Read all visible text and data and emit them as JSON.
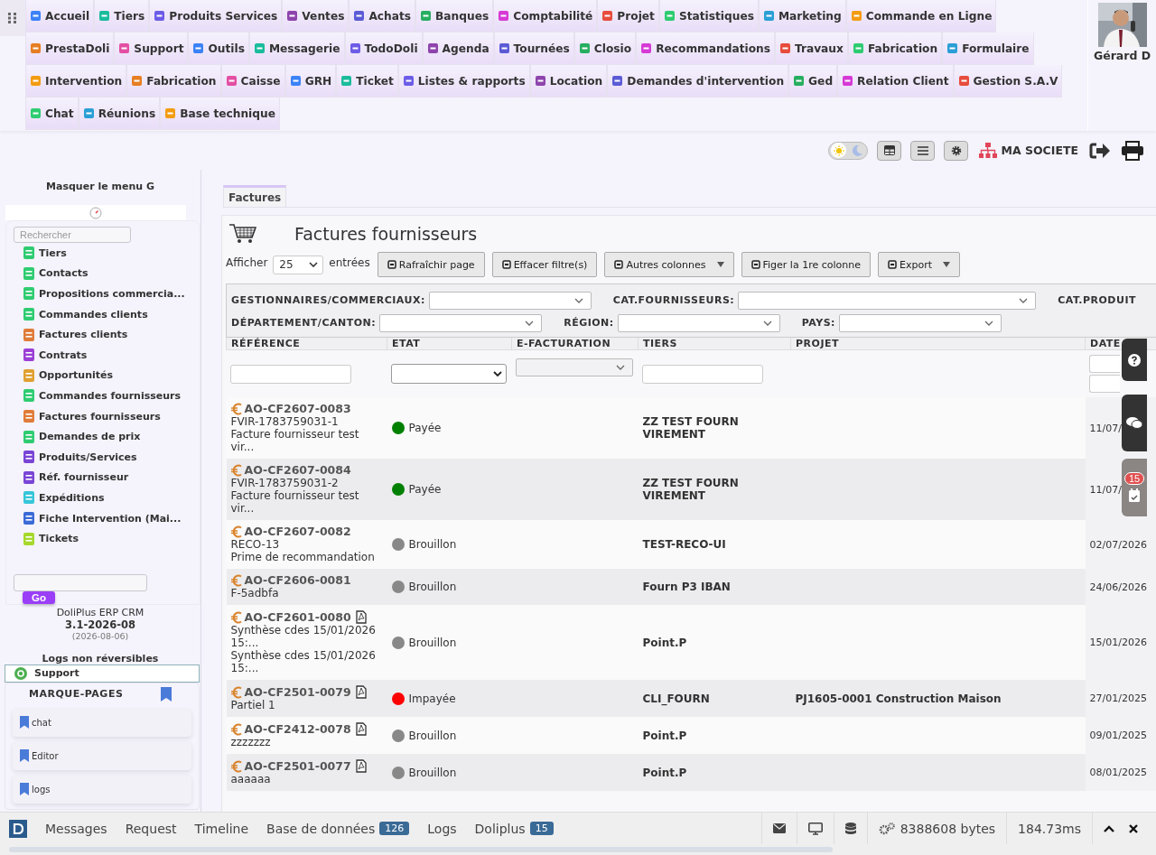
{
  "top_menu": {
    "items": [
      {
        "label": "Accueil"
      },
      {
        "label": "Tiers"
      },
      {
        "label": "Produits Services"
      },
      {
        "label": "Ventes"
      },
      {
        "label": "Achats"
      },
      {
        "label": "Banques"
      },
      {
        "label": "Comptabilité"
      },
      {
        "label": "Projet"
      },
      {
        "label": "Statistiques"
      },
      {
        "label": "Marketing"
      },
      {
        "label": "Commande en Ligne"
      },
      {
        "label": "PrestaDoli"
      },
      {
        "label": "Support"
      },
      {
        "label": "Outils"
      },
      {
        "label": "Messagerie"
      },
      {
        "label": "TodoDoli"
      },
      {
        "label": "Agenda"
      },
      {
        "label": "Tournées"
      },
      {
        "label": "Closio"
      },
      {
        "label": "Recommandations"
      },
      {
        "label": "Travaux"
      },
      {
        "label": "Fabrication"
      },
      {
        "label": "Formulaire"
      },
      {
        "label": "Intervention"
      },
      {
        "label": "Fabrication"
      },
      {
        "label": "Caisse"
      },
      {
        "label": "GRH"
      },
      {
        "label": "Ticket"
      },
      {
        "label": "Listes & rapports"
      },
      {
        "label": "Location"
      },
      {
        "label": "Demandes d'intervention"
      },
      {
        "label": "Ged"
      },
      {
        "label": "Relation Client"
      },
      {
        "label": "Gestion S.A.V"
      },
      {
        "label": "Chat"
      },
      {
        "label": "Réunions"
      },
      {
        "label": "Base technique"
      }
    ]
  },
  "user": {
    "name": "Gérard D"
  },
  "toolbar": {
    "dark_mode": false,
    "company": "MA SOCIETE"
  },
  "sidebar": {
    "hide_menu": "Masquer le menu G",
    "search": {
      "placeholder": "Rechercher"
    },
    "items": [
      {
        "label": "Tiers"
      },
      {
        "label": "Contacts"
      },
      {
        "label": "Propositions commercia..."
      },
      {
        "label": "Commandes clients"
      },
      {
        "label": "Factures clients"
      },
      {
        "label": "Contrats"
      },
      {
        "label": "Opportunités"
      },
      {
        "label": "Commandes fournisseurs"
      },
      {
        "label": "Factures fournisseurs"
      },
      {
        "label": "Demandes de prix"
      },
      {
        "label": "Produits/Services"
      },
      {
        "label": "Réf. fournisseur"
      },
      {
        "label": "Expéditions"
      },
      {
        "label": "Fiche Intervention (Mai..."
      },
      {
        "label": "Tickets"
      }
    ],
    "go_button": "Go",
    "app_name": "DoliPlus ERP CRM",
    "version": "3.1-2026-08",
    "build_date": "(2026-08-06)",
    "logs_note": "Logs non réversibles",
    "support": "Support",
    "bookmarks": {
      "title": "MARQUE-PAGES",
      "items": [
        "chat",
        "Editor",
        "logs"
      ]
    }
  },
  "main": {
    "tabs": [
      {
        "label": "Factures",
        "selected": true
      }
    ],
    "title": "Factures fournisseurs",
    "show_label": "Afficher",
    "page_size": "25",
    "entries_label": "entrées",
    "buttons": [
      {
        "label": "Rafraîchir page",
        "dropdown": false
      },
      {
        "label": "Effacer filtre(s)",
        "dropdown": false
      },
      {
        "label": "Autres colonnes",
        "dropdown": true
      },
      {
        "label": "Figer la 1re colonne",
        "dropdown": false
      },
      {
        "label": "Export",
        "dropdown": true
      }
    ],
    "filters": [
      [
        "GESTIONNAIRES/COMMERCIAUX:",
        "CAT.FOURNISSEURS:",
        "CAT.PRODUIT"
      ],
      [
        "DÉPARTEMENT/CANTON:",
        "RÉGION:",
        "PAYS:"
      ]
    ],
    "table": {
      "columns": [
        "RÉFÉRENCE",
        "ETAT",
        "E-FACTURATION",
        "TIERS",
        "PROJET",
        "DATE"
      ],
      "rows": [
        {
          "ref": "AO-CF2607-0083",
          "pdf": false,
          "lines": [
            "FVIR-1783759031-1",
            "Facture fournisseur test vir..."
          ],
          "status": {
            "label": "Payée",
            "color": "#008000"
          },
          "tiers": "ZZ TEST FOURN VIREMENT",
          "projet": "",
          "date": "11/07/"
        },
        {
          "ref": "AO-CF2607-0084",
          "pdf": false,
          "lines": [
            "FVIR-1783759031-2",
            "Facture fournisseur test vir..."
          ],
          "status": {
            "label": "Payée",
            "color": "#008000"
          },
          "tiers": "ZZ TEST FOURN VIREMENT",
          "projet": "",
          "date": "11/07/"
        },
        {
          "ref": "AO-CF2607-0082",
          "pdf": false,
          "lines": [
            "RECO-13",
            "Prime de recommandation"
          ],
          "status": {
            "label": "Brouillon",
            "color": "#888888"
          },
          "tiers": "TEST-RECO-UI",
          "projet": "",
          "date": "02/07/2026"
        },
        {
          "ref": "AO-CF2606-0081",
          "pdf": false,
          "lines": [
            "F-5adbfa"
          ],
          "status": {
            "label": "Brouillon",
            "color": "#888888"
          },
          "tiers": "Fourn P3 IBAN",
          "projet": "",
          "date": "24/06/2026"
        },
        {
          "ref": "AO-CF2601-0080",
          "pdf": true,
          "lines": [
            "Synthèse cdes 15/01/2026 15:...",
            "Synthèse cdes 15/01/2026 15:..."
          ],
          "status": {
            "label": "Brouillon",
            "color": "#888888"
          },
          "tiers": "Point.P",
          "projet": "",
          "date": "15/01/2026"
        },
        {
          "ref": "AO-CF2501-0079",
          "pdf": true,
          "lines": [
            "Partiel 1"
          ],
          "status": {
            "label": "Impayée",
            "color": "#ff0000"
          },
          "tiers": "CLI_FOURN",
          "projet": "PJ1605-0001 Construction Maison",
          "date": "27/01/2025"
        },
        {
          "ref": "AO-CF2412-0078",
          "pdf": true,
          "lines": [
            "zzzzzzz"
          ],
          "status": {
            "label": "Brouillon",
            "color": "#888888"
          },
          "tiers": "Point.P",
          "projet": "",
          "date": "09/01/2025"
        },
        {
          "ref": "AO-CF2501-0077",
          "pdf": true,
          "lines": [
            "aaaaaa"
          ],
          "status": {
            "label": "Brouillon",
            "color": "#888888"
          },
          "tiers": "Point.P",
          "projet": "",
          "date": "08/01/2025"
        }
      ]
    },
    "side_badge": "15"
  },
  "debug_bar": {
    "tabs": [
      {
        "label": "Messages"
      },
      {
        "label": "Request"
      },
      {
        "label": "Timeline"
      },
      {
        "label": "Base de données",
        "count": "126"
      },
      {
        "label": "Logs"
      },
      {
        "label": "Doliplus",
        "count": "15"
      }
    ],
    "memory": "8388608 bytes",
    "time": "184.73ms"
  }
}
